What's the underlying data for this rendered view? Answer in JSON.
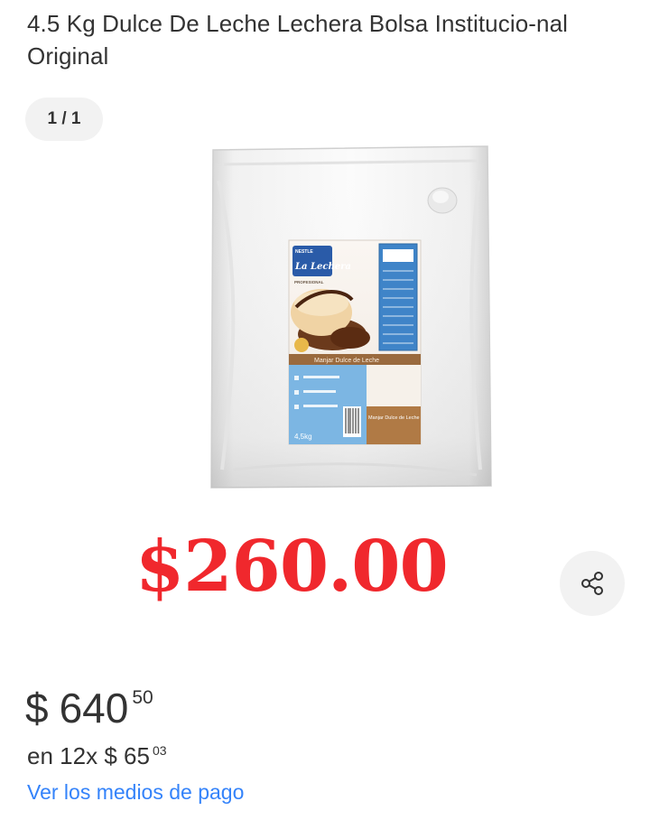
{
  "product": {
    "title": "4.5 Kg Dulce De Leche Lechera Bolsa Institucio-nal Original",
    "image_alt": "Bolsa blanca de Dulce de Leche La Lechera Profesional 4,5kg",
    "package": {
      "brand_top": "NESTLE",
      "brand": "La Lechera",
      "line": "PROFESIONAL",
      "band": "Manjar Dulce de Leche",
      "weight": "4,5kg",
      "bottom_label": "Manjar Dulce de Leche"
    }
  },
  "gallery": {
    "counter": "1 / 1"
  },
  "promo": {
    "price": "$260.00",
    "color": "#f0282d"
  },
  "share": {
    "icon": "share-icon"
  },
  "pricing": {
    "currency": "$",
    "amount": "640",
    "cents": "50",
    "installments_prefix": "en 12x",
    "installments_currency": "$",
    "installments_amount": "65",
    "installments_cents": "03"
  },
  "payment": {
    "link_label": "Ver los medios de pago",
    "link_color": "#3483fa"
  }
}
